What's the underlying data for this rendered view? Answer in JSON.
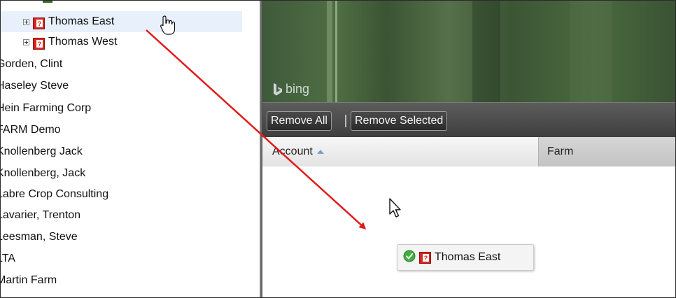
{
  "tree": {
    "children": [
      {
        "label": "Thomas East",
        "icon": "farm-icon",
        "selected": true
      },
      {
        "label": "Thomas West",
        "icon": "farm-icon",
        "selected": false
      }
    ],
    "accounts": [
      "Gorden, Clint",
      "Haseley Steve",
      "Hein Farming Corp",
      "FARM Demo",
      "Knollenberg Jack",
      "Knollenberg, Jack",
      "Labre Crop Consulting",
      "Lavarier, Trenton",
      "Leesman, Steve",
      "LTA",
      "Martin Farm"
    ]
  },
  "map": {
    "attribution": "bing"
  },
  "toolbar": {
    "remove_all_label": "Remove All",
    "remove_selected_label": "Remove Selected"
  },
  "grid": {
    "columns": [
      "Account",
      "Farm"
    ],
    "sort_column": "Account",
    "sort_direction": "ascending"
  },
  "drag_proxy": {
    "label": "Thomas East",
    "status_icon": "check-icon",
    "item_icon": "farm-icon"
  },
  "colors": {
    "arrow": "#e01b1b",
    "toolbar": "#4a4a4a",
    "selected_row": "#e8f0fb",
    "check": "#3fae3f"
  }
}
